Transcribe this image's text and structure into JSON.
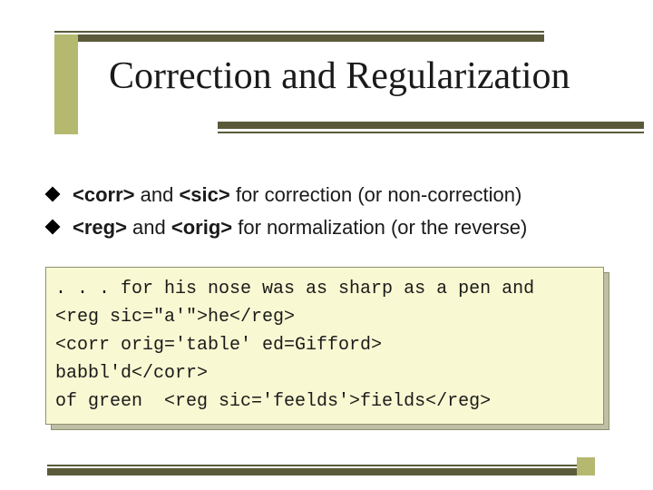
{
  "title": "Correction and Regularization",
  "bullets": [
    {
      "tag1": "<corr>",
      "mid1": " and ",
      "tag2": "<sic>",
      "rest": " for correction (or non-correction)"
    },
    {
      "tag1": "<reg>",
      "mid1": " and ",
      "tag2": "<orig>",
      "rest": " for normalization (or the reverse)"
    }
  ],
  "code": ". . . for his nose was as sharp as a pen and\n<reg sic=\"a'\">he</reg>\n<corr orig='table' ed=Gifford>\nbabbl'd</corr>\nof green  <reg sic='feelds'>fields</reg>"
}
